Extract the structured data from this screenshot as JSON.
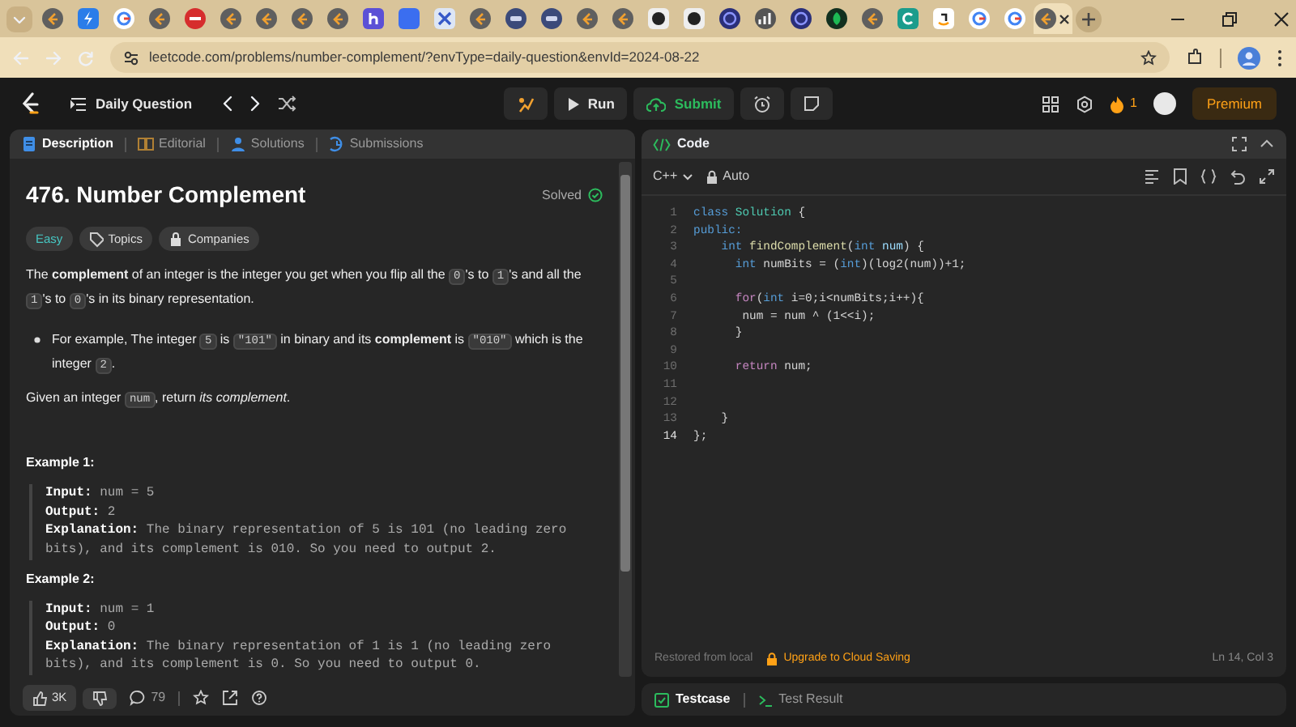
{
  "browser": {
    "tabs": [
      {
        "kind": "leetcode",
        "selected": false
      },
      {
        "kind": "bolt",
        "selected": false
      },
      {
        "kind": "google",
        "selected": false
      },
      {
        "kind": "leetcode",
        "selected": false
      },
      {
        "kind": "red",
        "selected": false
      },
      {
        "kind": "leetcode",
        "selected": false
      },
      {
        "kind": "leetcode",
        "selected": false
      },
      {
        "kind": "leetcode",
        "selected": false
      },
      {
        "kind": "leetcode",
        "selected": false
      },
      {
        "kind": "letter",
        "selected": false
      },
      {
        "kind": "square",
        "selected": false
      },
      {
        "kind": "cross",
        "selected": false
      },
      {
        "kind": "leetcode",
        "selected": false
      },
      {
        "kind": "un",
        "selected": false
      },
      {
        "kind": "un",
        "selected": false
      },
      {
        "kind": "leetcode",
        "selected": false
      },
      {
        "kind": "leetcode",
        "selected": false
      },
      {
        "kind": "dark",
        "selected": false
      },
      {
        "kind": "dark",
        "selected": false
      },
      {
        "kind": "ring",
        "selected": false
      },
      {
        "kind": "chart",
        "selected": false
      },
      {
        "kind": "ring",
        "selected": false
      },
      {
        "kind": "leaf",
        "selected": false
      },
      {
        "kind": "leetcode",
        "selected": false
      },
      {
        "kind": "cee",
        "selected": false
      },
      {
        "kind": "amazon",
        "selected": false
      },
      {
        "kind": "google",
        "selected": false
      },
      {
        "kind": "google",
        "selected": false
      },
      {
        "kind": "leetcode",
        "selected": true
      }
    ],
    "url": "leetcode.com/problems/number-complement/?envType=daily-question&envId=2024-08-22"
  },
  "nav": {
    "list_title": "Daily Question",
    "run": "Run",
    "submit": "Submit",
    "streak": "1",
    "premium": "Premium"
  },
  "left_tabs": [
    {
      "label": "Description",
      "selected": true
    },
    {
      "label": "Editorial",
      "selected": false
    },
    {
      "label": "Solutions",
      "selected": false
    },
    {
      "label": "Submissions",
      "selected": false
    }
  ],
  "problem": {
    "title": "476. Number Complement",
    "status": "Solved",
    "difficulty": "Easy",
    "tags": [
      "Topics",
      "Companies"
    ],
    "paragraphs": [
      {
        "kind": "text",
        "parts": [
          {
            "t": "The **complement** of an integer is the integer you get when you flip all the ",
            "code": false
          },
          {
            "t": "0",
            "code": true
          },
          {
            "t": "'s to ",
            "code": false
          },
          {
            "t": "1",
            "code": true
          },
          {
            "t": "'s and all the ",
            "code": false
          },
          {
            "t": "1",
            "code": true
          },
          {
            "t": "'s to ",
            "code": false
          },
          {
            "t": "0",
            "code": true
          },
          {
            "t": "'s in its binary representation.",
            "code": false
          }
        ]
      },
      {
        "kind": "bullet",
        "parts": [
          {
            "t": "For example, The integer ",
            "code": false
          },
          {
            "t": "5",
            "code": true
          },
          {
            "t": " is ",
            "code": false
          },
          {
            "t": "\"101\"",
            "code": true
          },
          {
            "t": " in binary and its **complement** is ",
            "code": false
          },
          {
            "t": "\"010\"",
            "code": true
          },
          {
            "t": " which is the integer ",
            "code": false
          },
          {
            "t": "2",
            "code": true
          },
          {
            "t": ".",
            "code": false
          }
        ]
      },
      {
        "kind": "text",
        "parts": [
          {
            "t": "Given an integer ",
            "code": false
          },
          {
            "t": "num",
            "code": true
          },
          {
            "t": ", return *its complement*.",
            "code": false
          }
        ]
      }
    ],
    "examples": [
      {
        "title": "Example 1:",
        "lines": [
          {
            "label": "Input:",
            "value": "num = 5"
          },
          {
            "label": "Output:",
            "value": "2"
          },
          {
            "label": "Explanation:",
            "value": "The binary representation of 5 is 101 (no leading zero bits), and its complement is 010. So you need to output 2."
          }
        ]
      },
      {
        "title": "Example 2:",
        "lines": [
          {
            "label": "Input:",
            "value": "num = 1"
          },
          {
            "label": "Output:",
            "value": "0"
          },
          {
            "label": "Explanation:",
            "value": "The binary representation of 1 is 1 (no leading zero bits), and its complement is 0. So you need to output 0."
          }
        ]
      }
    ],
    "likes": "3K",
    "comments": "79"
  },
  "code": {
    "title": "Code",
    "language": "C++",
    "mode": "Auto",
    "lines": [
      {
        "n": "1",
        "current": false,
        "tokens": [
          {
            "t": "class ",
            "kind": "kw"
          },
          {
            "t": "Solution",
            "kind": "type"
          },
          {
            "t": " {",
            "kind": "plain"
          }
        ]
      },
      {
        "n": "2",
        "current": false,
        "tokens": [
          {
            "t": "public:",
            "kind": "kw"
          }
        ]
      },
      {
        "n": "3",
        "current": false,
        "tokens": [
          {
            "t": "    int ",
            "kind": "kw"
          },
          {
            "t": "findComplement",
            "kind": "fn"
          },
          {
            "t": "(",
            "kind": "plain"
          },
          {
            "t": "int ",
            "kind": "kw"
          },
          {
            "t": "num",
            "kind": "var"
          },
          {
            "t": ") {",
            "kind": "plain"
          }
        ]
      },
      {
        "n": "4",
        "current": false,
        "tokens": [
          {
            "t": "      int ",
            "kind": "kw"
          },
          {
            "t": "numBits = (",
            "kind": "plain"
          },
          {
            "t": "int",
            "kind": "kw"
          },
          {
            "t": ")(log2(num))+1;",
            "kind": "plain"
          }
        ]
      },
      {
        "n": "5",
        "current": false
      },
      {
        "n": "6",
        "current": false,
        "tokens": [
          {
            "t": "      for",
            "kind": "ctl"
          },
          {
            "t": "(",
            "kind": "plain"
          },
          {
            "t": "int ",
            "kind": "kw"
          },
          {
            "t": "i=0;i<numBits;i++){",
            "kind": "plain"
          }
        ]
      },
      {
        "n": "7",
        "current": false,
        "tokens": [
          {
            "t": "       num = num ^ (1<<i);",
            "kind": "plain"
          }
        ]
      },
      {
        "n": "8",
        "current": false,
        "tokens": [
          {
            "t": "      }",
            "kind": "plain"
          }
        ]
      },
      {
        "n": "9",
        "current": false
      },
      {
        "n": "10",
        "current": false,
        "tokens": [
          {
            "t": "      return ",
            "kind": "ctl"
          },
          {
            "t": "num;",
            "kind": "plain"
          }
        ]
      },
      {
        "n": "11",
        "current": false
      },
      {
        "n": "12",
        "current": false
      },
      {
        "n": "13",
        "current": false,
        "tokens": [
          {
            "t": "    }",
            "kind": "plain"
          }
        ]
      },
      {
        "n": "14",
        "current": true,
        "tokens": [
          {
            "t": "};",
            "kind": "plain"
          }
        ]
      }
    ],
    "restored": "Restored from local",
    "upgrade": "Upgrade to Cloud Saving",
    "cursor": "Ln 14, Col 3"
  },
  "bottom_tabs": [
    {
      "label": "Testcase",
      "selected": true
    },
    {
      "label": "Test Result",
      "selected": false
    }
  ]
}
